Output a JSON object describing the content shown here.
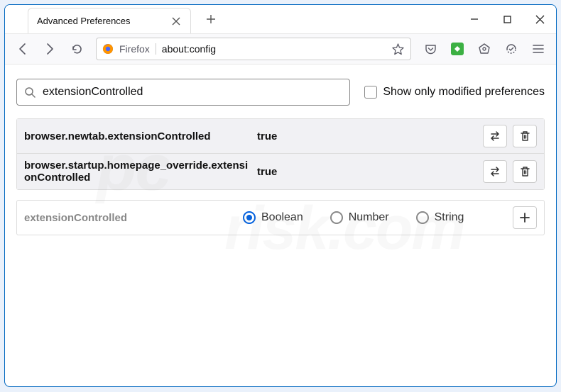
{
  "tab": {
    "title": "Advanced Preferences"
  },
  "urlbar": {
    "identity": "Firefox",
    "url": "about:config"
  },
  "search": {
    "value": "extensionControlled"
  },
  "checkbox_label": "Show only modified preferences",
  "prefs": [
    {
      "name": "browser.newtab.extensionControlled",
      "value": "true"
    },
    {
      "name": "browser.startup.homepage_override.extensionControlled",
      "value": "true"
    }
  ],
  "new_pref": {
    "name": "extensionControlled",
    "types": {
      "boolean": "Boolean",
      "number": "Number",
      "string": "String"
    }
  },
  "watermark": {
    "line1": "pc",
    "line2": "risk.com"
  }
}
